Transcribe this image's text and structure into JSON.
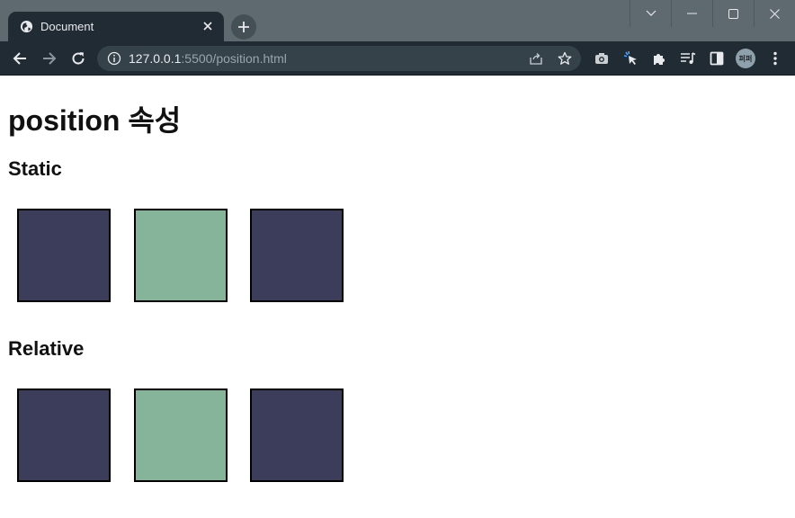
{
  "browser": {
    "tab": {
      "title": "Document",
      "favicon": "globe-icon",
      "close_icon": "close-icon"
    },
    "new_tab_icon": "plus-icon",
    "window_controls": [
      "chevron-down-icon",
      "minimize-icon",
      "maximize-icon",
      "close-icon"
    ],
    "toolbar": {
      "back_icon": "arrow-left-icon",
      "forward_icon": "arrow-right-icon",
      "reload_icon": "reload-icon",
      "address": {
        "host": "127.0.0.1",
        "rest": ":5500/position.html"
      },
      "info_icon": "info-icon",
      "share_icon": "share-icon",
      "bookmark_icon": "star-icon",
      "extensions": [
        "camera-icon",
        "cursor-click-icon",
        "puzzle-icon",
        "media-queue-icon",
        "side-panel-icon"
      ],
      "avatar_text": "퍼퍼",
      "menu_icon": "more-vert-icon"
    }
  },
  "page": {
    "title": "position 속성",
    "sections": [
      {
        "heading": "Static",
        "boxes": [
          "dark",
          "green",
          "dark"
        ]
      },
      {
        "heading": "Relative",
        "boxes": [
          "dark",
          "green",
          "dark"
        ]
      }
    ]
  },
  "colors": {
    "dark_box": "#3b3d5a",
    "green_box": "#86b49b",
    "chrome_dark": "#202b33",
    "titlebar": "#5f6a70"
  }
}
